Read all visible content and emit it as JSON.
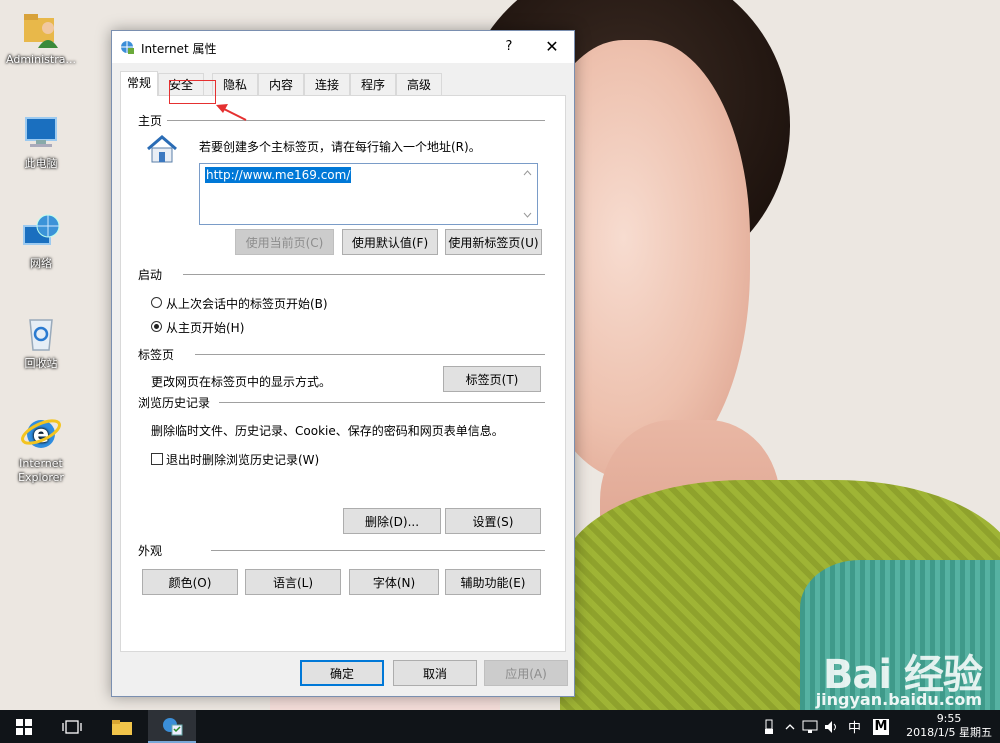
{
  "desktop": {
    "icons": [
      {
        "label": "Administra..."
      },
      {
        "label": "此电脑"
      },
      {
        "label": "网络"
      },
      {
        "label": "回收站"
      },
      {
        "label": "Internet",
        "label2": "Explorer"
      }
    ],
    "watermark": "Bai 经验",
    "watermark_url": "jingyan.baidu.com"
  },
  "dialog": {
    "title": "Internet 属性",
    "help": "?",
    "close": "✕",
    "tabs": [
      "常规",
      "安全",
      "隐私",
      "内容",
      "连接",
      "程序",
      "高级"
    ],
    "active_tab": "常规",
    "home": {
      "heading": "主页",
      "instruction": "若要创建多个主标签页，请在每行输入一个地址(R)。",
      "url": "http://www.me169.com/",
      "use_current": "使用当前页(C)",
      "use_default": "使用默认值(F)",
      "use_new_tab": "使用新标签页(U)"
    },
    "startup": {
      "heading": "启动",
      "option_last_session": "从上次会话中的标签页开始(B)",
      "option_home": "从主页开始(H)",
      "selected": "从主页开始(H)"
    },
    "tabs_section": {
      "heading": "标签页",
      "description": "更改网页在标签页中的显示方式。",
      "button": "标签页(T)"
    },
    "history": {
      "heading": "浏览历史记录",
      "description": "删除临时文件、历史记录、Cookie、保存的密码和网页表单信息。",
      "checkbox_label": "退出时删除浏览历史记录(W)",
      "checkbox_checked": false,
      "delete_button": "删除(D)...",
      "settings_button": "设置(S)"
    },
    "appearance": {
      "heading": "外观",
      "colors": "颜色(O)",
      "languages": "语言(L)",
      "fonts": "字体(N)",
      "accessibility": "辅助功能(E)"
    },
    "footer": {
      "ok": "确定",
      "cancel": "取消",
      "apply": "应用(A)"
    }
  },
  "taskbar": {
    "ime": "中",
    "ime2": "M",
    "time": "9:55",
    "date": "2018/1/5 星期五"
  },
  "colors": {
    "accent": "#0078d7",
    "annotation": "#e53030"
  }
}
